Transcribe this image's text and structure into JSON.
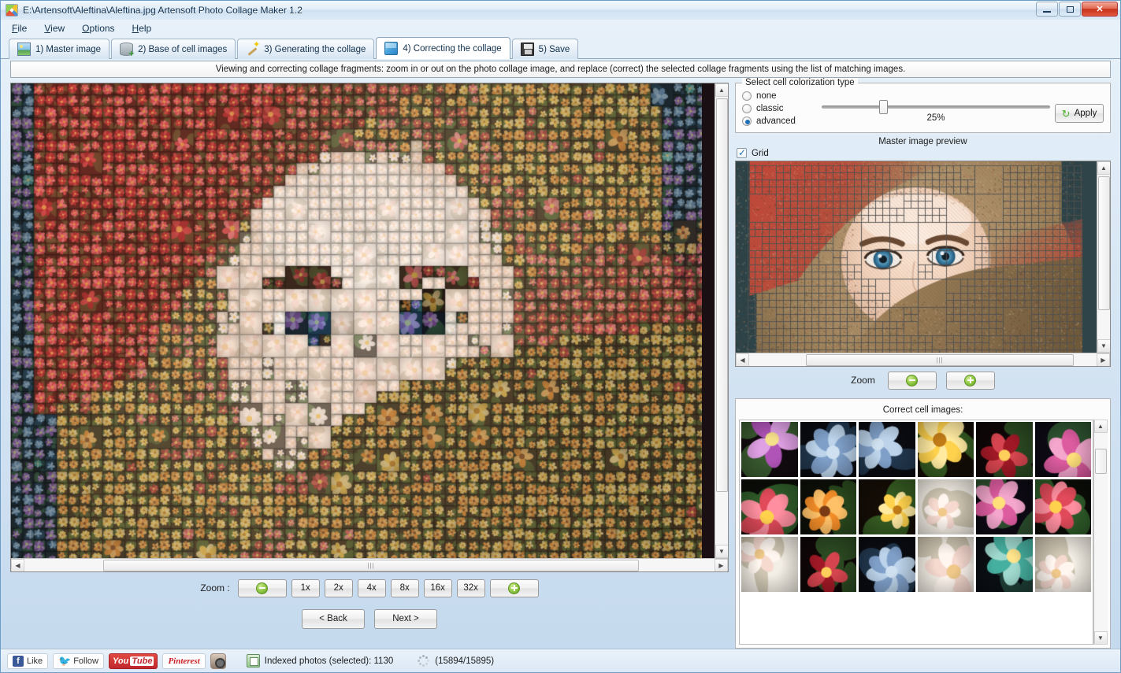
{
  "window": {
    "title": "E:\\Artensoft\\Aleftina\\Aleftina.jpg Artensoft Photo Collage Maker 1.2",
    "app_icon": "collage-app-icon",
    "minimize_label": "–",
    "maximize_label": "□",
    "close_label": "✕"
  },
  "menu": {
    "items": [
      {
        "label": "File"
      },
      {
        "label": "View"
      },
      {
        "label": "Options"
      },
      {
        "label": "Help"
      }
    ]
  },
  "tabs": [
    {
      "label": "1) Master image",
      "icon": "picture-icon",
      "active": false
    },
    {
      "label": "2) Base of cell images",
      "icon": "database-add-icon",
      "active": false
    },
    {
      "label": "3) Generating the collage",
      "icon": "magic-wand-icon",
      "active": false
    },
    {
      "label": "4) Correcting the collage",
      "icon": "blue-cube-icon",
      "active": true
    },
    {
      "label": "5) Save",
      "icon": "floppy-disk-icon",
      "active": false
    }
  ],
  "instruction": "Viewing and correcting collage fragments: zoom in or out on the photo collage image, and replace (correct) the selected collage fragments using the list of matching images.",
  "colorization": {
    "group_title": "Select cell colorization type",
    "options": [
      {
        "label": "none",
        "selected": false
      },
      {
        "label": "classic",
        "selected": false
      },
      {
        "label": "advanced",
        "selected": true
      }
    ],
    "slider_value": "25%",
    "slider_percent": 25,
    "apply_label": "Apply",
    "apply_icon": "refresh-icon"
  },
  "preview": {
    "title": "Master image preview",
    "grid_label": "Grid",
    "grid_checked": true,
    "zoom_label": "Zoom",
    "zoom_out_icon": "minus-circle-icon",
    "zoom_in_icon": "plus-circle-icon"
  },
  "cells": {
    "title": "Correct cell images:",
    "thumbnails": [
      {
        "name": "purple-iris"
      },
      {
        "name": "blue-rose-1"
      },
      {
        "name": "blue-rose-2"
      },
      {
        "name": "bird-of-paradise-1"
      },
      {
        "name": "red-rosebud-branch-1"
      },
      {
        "name": "pink-dahlia-1"
      },
      {
        "name": "red-buds-cluster-1"
      },
      {
        "name": "orange-rose"
      },
      {
        "name": "bird-of-paradise-2"
      },
      {
        "name": "pink-tulip-buds-1"
      },
      {
        "name": "pink-dahlia-2"
      },
      {
        "name": "red-buds-cluster-2"
      },
      {
        "name": "white-pink-tulip-1"
      },
      {
        "name": "red-rosebud-branch-2"
      },
      {
        "name": "blue-rose-3"
      },
      {
        "name": "white-pink-tulip-2"
      },
      {
        "name": "blue-columbine"
      },
      {
        "name": "pink-tulip-bouquet"
      }
    ]
  },
  "collage_zoom": {
    "label": "Zoom :",
    "zoom_out_icon": "minus-circle-icon",
    "zoom_in_icon": "plus-circle-icon",
    "levels": [
      "1x",
      "2x",
      "4x",
      "8x",
      "16x",
      "32x"
    ]
  },
  "navigation": {
    "back_label": "< Back",
    "next_label": "Next >"
  },
  "statusbar": {
    "social": [
      {
        "name": "facebook-like",
        "label": "Like"
      },
      {
        "name": "twitter-follow",
        "label": "Follow"
      },
      {
        "name": "youtube",
        "label": "You",
        "label2": "Tube"
      },
      {
        "name": "pinterest",
        "label": "Pinterest"
      },
      {
        "name": "instagram",
        "label": ""
      }
    ],
    "indexed_text": "Indexed photos (selected): 1130",
    "progress_text": "(15894/15895)"
  },
  "colors": {
    "accent": "#1f6fb5",
    "green": "#8cc63f",
    "title_bar": "#dceaf7",
    "close_red": "#c6321c"
  }
}
